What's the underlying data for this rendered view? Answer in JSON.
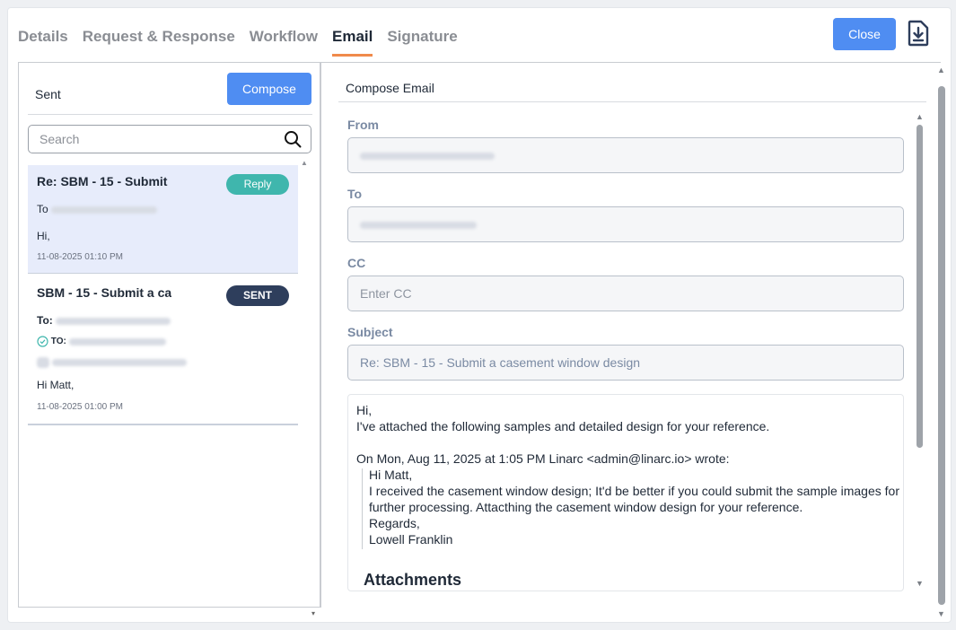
{
  "tabs": [
    {
      "label": "Details"
    },
    {
      "label": "Request & Response"
    },
    {
      "label": "Workflow"
    },
    {
      "label": "Email",
      "active": true
    },
    {
      "label": "Signature"
    }
  ],
  "header": {
    "close_label": "Close",
    "download_icon": "download-file-icon"
  },
  "sidebar": {
    "title": "Sent",
    "compose_label": "Compose",
    "search_placeholder": "Search",
    "emails": [
      {
        "subject": "Re: SBM - 15 - Submit",
        "badge": "Reply",
        "to_label": "To",
        "body": "Hi,",
        "date": "11-08-2025 01:10 PM"
      },
      {
        "subject": "SBM - 15 - Submit a ca",
        "badge": "SENT",
        "to_label": "To:",
        "to2_label": "TO:",
        "body": "Hi Matt,",
        "date": "11-08-2025 01:00 PM"
      }
    ]
  },
  "compose": {
    "title": "Compose Email",
    "from_label": "From",
    "to_label": "To",
    "cc_label": "CC",
    "cc_placeholder": "Enter CC",
    "subject_label": "Subject",
    "subject_value": "Re: SBM - 15 - Submit a casement window design",
    "body_lines": [
      "Hi,",
      "I've attached the following samples and detailed design for your reference.",
      "On Mon, Aug 11, 2025 at 1:05 PM Linarc <admin@linarc.io> wrote:"
    ],
    "quoted_lines": [
      "Hi Matt,",
      "I received the casement window design; It'd be better if you could submit the sample images for",
      "further processing. Attacthing the casement window design for your reference.",
      "Regards,",
      "Lowell Franklin"
    ],
    "attachments_heading": "Attachments"
  },
  "colors": {
    "primary": "#4f8df2",
    "tab_underline": "#f08a4b",
    "reply_badge": "#3fb6ad",
    "sent_badge": "#2e3e5c",
    "selected_row": "#e7ecfb"
  }
}
